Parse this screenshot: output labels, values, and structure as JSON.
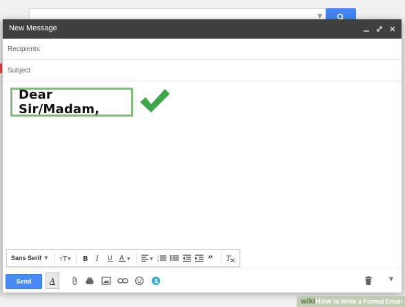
{
  "compose": {
    "title": "New Message",
    "recipients_placeholder": "Recipients",
    "subject_placeholder": "Subject",
    "body_text": "Dear Sir/Madam,"
  },
  "format_bar": {
    "font_family": "Sans Serif"
  },
  "actions": {
    "send_label": "Send"
  },
  "watermark": {
    "logo_prefix": "wiki",
    "logo_suffix": "How",
    "article_title": "to Write a Formal Email"
  },
  "colors": {
    "accent": "#4a8af4",
    "highlight": "#7dbf7a",
    "titlebar": "#404040",
    "check": "#3da84a"
  }
}
